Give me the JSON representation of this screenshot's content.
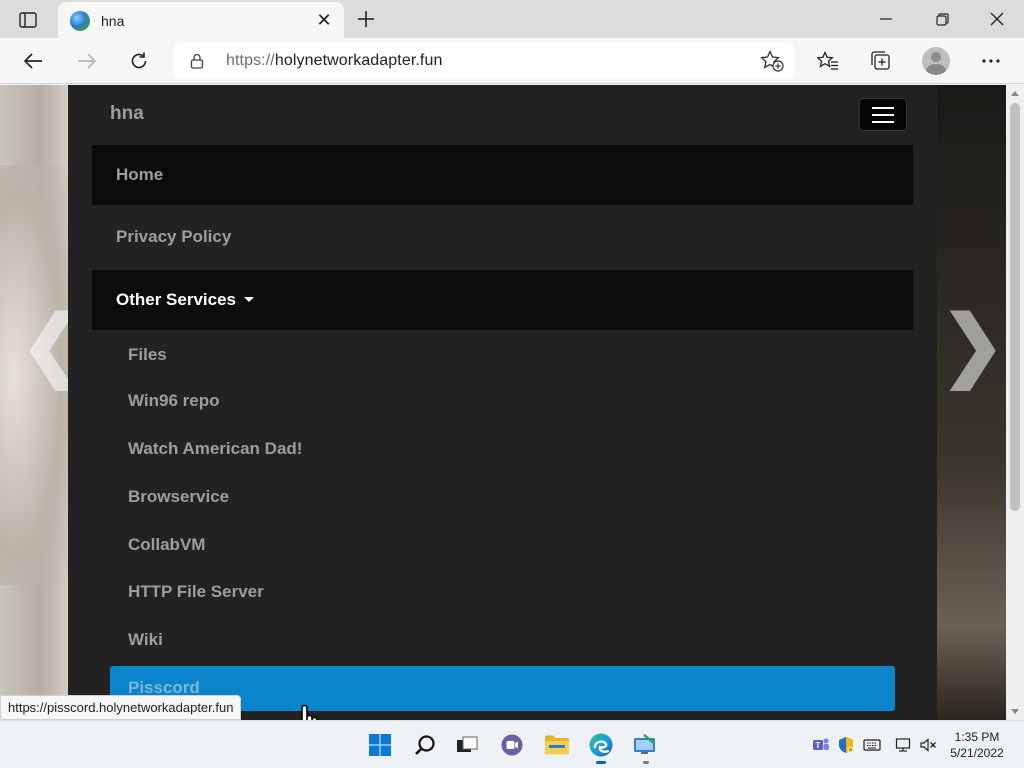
{
  "browser": {
    "tab": {
      "title": "hna"
    },
    "address": {
      "protocol": "https://",
      "host": "holynetworkadapter.fun"
    },
    "status_url": "https://pisscord.holynetworkadapter.fun"
  },
  "page": {
    "brand": "hna",
    "nav": {
      "home": "Home",
      "privacy": "Privacy Policy",
      "other_services": "Other Services"
    },
    "dropdown": [
      "Files",
      "Win96 repo",
      "Watch American Dad!",
      "Browservice",
      "CollabVM",
      "HTTP File Server",
      "Wiki",
      "Pisscord"
    ],
    "carousel": {
      "prev": "❮",
      "next": "❯"
    }
  },
  "taskbar": {
    "time": "1:35 PM",
    "date": "5/21/2022"
  },
  "colors": {
    "navbar_bg": "#222222",
    "active_bg": "#0a85cc",
    "link_color": "#9d9d9d"
  }
}
